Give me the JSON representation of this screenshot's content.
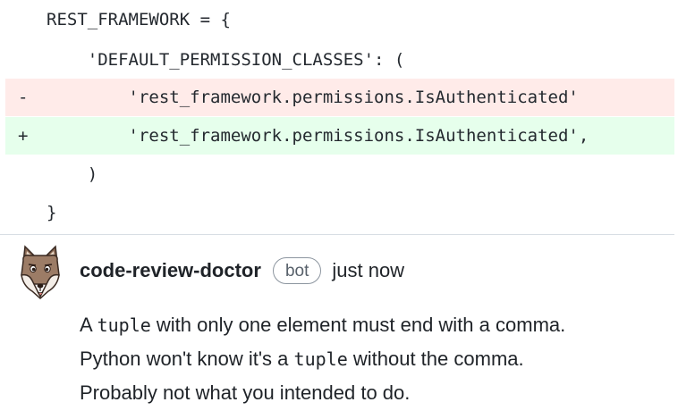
{
  "diff": {
    "lines": [
      {
        "marker": "",
        "code": "REST_FRAMEWORK = {",
        "type": "context"
      },
      {
        "marker": "",
        "code": "    'DEFAULT_PERMISSION_CLASSES': (",
        "type": "context"
      },
      {
        "marker": "-",
        "code": "        'rest_framework.permissions.IsAuthenticated'",
        "type": "removed"
      },
      {
        "marker": "+",
        "code": "        'rest_framework.permissions.IsAuthenticated',",
        "type": "added"
      },
      {
        "marker": "",
        "code": "    )",
        "type": "context"
      },
      {
        "marker": "",
        "code": "}",
        "type": "context"
      }
    ]
  },
  "comment": {
    "avatar_icon": "fox-avatar-icon",
    "author": "code-review-doctor",
    "badge": "bot",
    "timestamp": "just now",
    "body": [
      {
        "pre": "A ",
        "code": "tuple",
        "post": " with only one element must end with a comma."
      },
      {
        "pre": "Python won't know it's a ",
        "code": "tuple",
        "post": " without the comma."
      },
      {
        "pre": "Probably not what you intended to do.",
        "code": "",
        "post": ""
      }
    ]
  },
  "colors": {
    "removed_bg": "#ffebe9",
    "added_bg": "#e6ffec",
    "divider": "#d8dee4",
    "badge_border": "#8c959f"
  }
}
